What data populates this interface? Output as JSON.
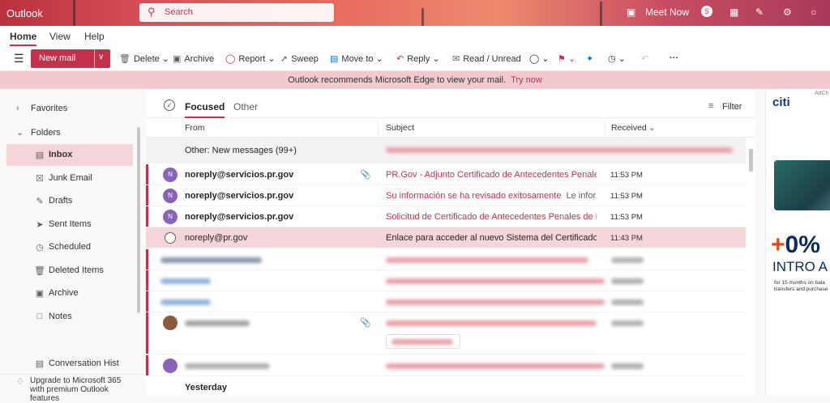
{
  "app": {
    "title": "Outlook"
  },
  "search": {
    "placeholder": "Search"
  },
  "topbar": {
    "meet_now": "Meet Now"
  },
  "ribbon": {
    "tabs": [
      "Home",
      "View",
      "Help"
    ]
  },
  "toolbar": {
    "new_mail": "New mail",
    "delete": "Delete",
    "archive": "Archive",
    "report": "Report",
    "sweep": "Sweep",
    "move_to": "Move to",
    "reply": "Reply",
    "read_unread": "Read / Unread"
  },
  "banner": {
    "text": "Outlook recommends Microsoft Edge to view your mail.",
    "link": "Try now"
  },
  "nav": {
    "favorites": "Favorites",
    "folders": "Folders",
    "items": [
      {
        "label": "Inbox",
        "icon": "inbox-icon"
      },
      {
        "label": "Junk Email",
        "icon": "junk-icon"
      },
      {
        "label": "Drafts",
        "icon": "pencil-icon"
      },
      {
        "label": "Sent Items",
        "icon": "send-icon"
      },
      {
        "label": "Scheduled",
        "icon": "clock-icon"
      },
      {
        "label": "Deleted Items",
        "icon": "trash-icon"
      },
      {
        "label": "Archive",
        "icon": "archive-icon"
      },
      {
        "label": "Notes",
        "icon": "note-icon"
      },
      {
        "label": "Conversation Hist",
        "icon": "folder-icon"
      }
    ],
    "upgrade_line1": "Upgrade to Microsoft 365",
    "upgrade_line2": "with premium Outlook",
    "upgrade_line3": "features"
  },
  "list": {
    "pivot_focused": "Focused",
    "pivot_other": "Other",
    "filter": "Filter",
    "col_from": "From",
    "col_subject": "Subject",
    "col_received": "Received",
    "group_label": "Other: New messages (99+)",
    "day_label": "Yesterday",
    "rows": [
      {
        "avatar": "N",
        "sender": "noreply@servicios.pr.gov",
        "subject": "PR.Gov - Adjunto Certificado de Antecedentes Penales",
        "preview": "",
        "time": "11:53 PM"
      },
      {
        "avatar": "N",
        "sender": "noreply@servicios.pr.gov",
        "subject": "Su información se ha revisado exitosamente",
        "preview": "Le infor...",
        "time": "11:53 PM"
      },
      {
        "avatar": "N",
        "sender": "noreply@servicios.pr.gov",
        "subject": "Solicitud de Certificado de Antecedentes Penales de P...",
        "preview": "",
        "time": "11:53 PM"
      },
      {
        "avatar": "",
        "sender": "noreply@pr.gov",
        "subject": "Enlace para acceder al nuevo Sistema del Certificado de ...",
        "preview": "",
        "time": "11:43 PM"
      }
    ]
  },
  "ad": {
    "corner": "AdCh",
    "brand": "citi",
    "big": "0%",
    "intro": "INTRO A",
    "small1": "for 15 months on bala",
    "small2": "transfers and purchase"
  },
  "colors": {
    "accent": "#c4314b",
    "avatar": "#8764b8"
  }
}
